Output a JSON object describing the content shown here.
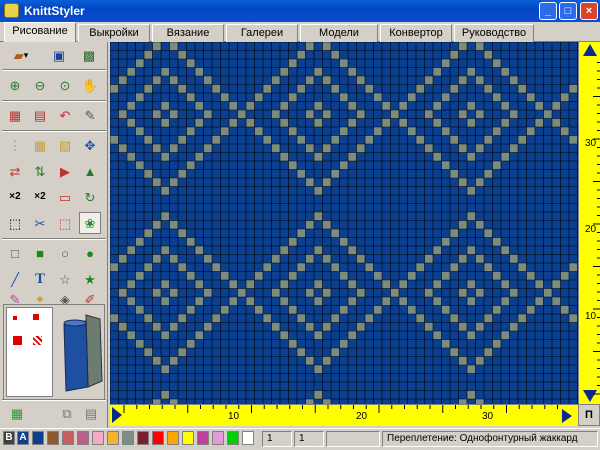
{
  "window": {
    "title": "KnittStyler"
  },
  "tabs": [
    {
      "label": "Рисование",
      "active": true
    },
    {
      "label": "Выкройки"
    },
    {
      "label": "Вязание"
    },
    {
      "label": "Галереи"
    },
    {
      "label": "Модели"
    },
    {
      "label": "Конвертор"
    },
    {
      "label": "Руководство"
    }
  ],
  "grid": {
    "background_color": "#0b3f8f",
    "pattern_color": "#7c8d80",
    "line_color": "#000000"
  },
  "vruler": {
    "labels": [
      "30",
      "20",
      "10"
    ]
  },
  "hruler": {
    "labels": [
      "10",
      "20",
      "30"
    ]
  },
  "palette": {
    "letter_b": "B",
    "letter_a": "A",
    "colors": [
      "#0b3f8f",
      "#8f5a2b",
      "#c46060",
      "#b85f8a",
      "#f7a8c8",
      "#f6b230",
      "#7f8c88",
      "#7a2030",
      "#ff0000",
      "#ffa500",
      "#ffff00",
      "#c040a0",
      "#e29bd6",
      "#00d000",
      "#ffffff"
    ]
  },
  "status": {
    "field1": "1",
    "field2": "1",
    "message": "Переплетение: Однофонтурный жаккард"
  },
  "right_button": "П"
}
